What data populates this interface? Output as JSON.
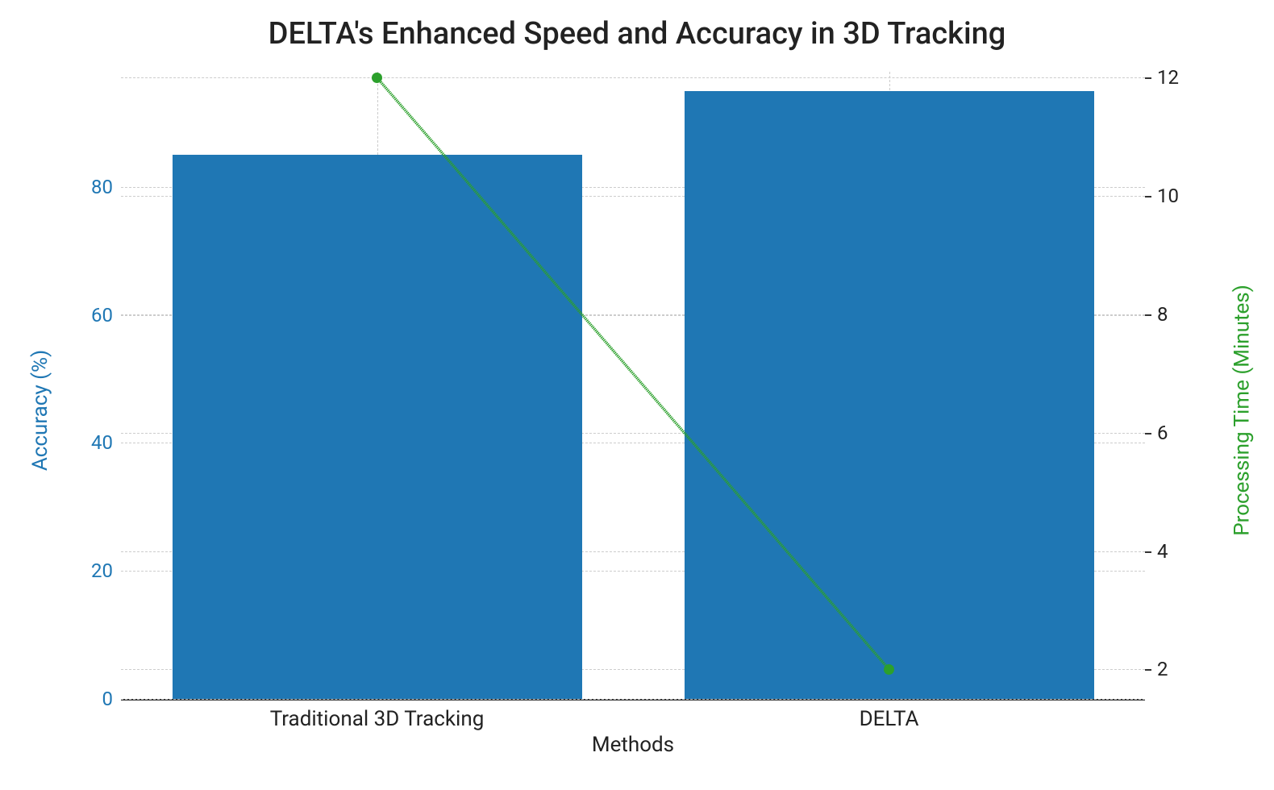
{
  "chart_data": {
    "type": "bar",
    "title": "DELTA's Enhanced Speed and Accuracy in 3D Tracking",
    "xlabel": "Methods",
    "ylabel_left": "Accuracy (%)",
    "ylabel_right": "Processing Time (Minutes)",
    "categories": [
      "Traditional 3D Tracking",
      "DELTA"
    ],
    "series": [
      {
        "name": "Accuracy (%)",
        "type": "bar",
        "axis": "left",
        "values": [
          85,
          95
        ],
        "color": "#1f77b4"
      },
      {
        "name": "Processing Time (Minutes)",
        "type": "line",
        "axis": "right",
        "values": [
          12,
          2
        ],
        "color": "#2ca02c",
        "style": "dashed",
        "marker": "o"
      }
    ],
    "ylim_left": [
      0,
      98
    ],
    "yticks_left": [
      0,
      20,
      40,
      60,
      80
    ],
    "ylim_right": [
      1.5,
      12.1
    ],
    "yticks_right": [
      2,
      4,
      6,
      8,
      10,
      12
    ],
    "grid": true
  }
}
